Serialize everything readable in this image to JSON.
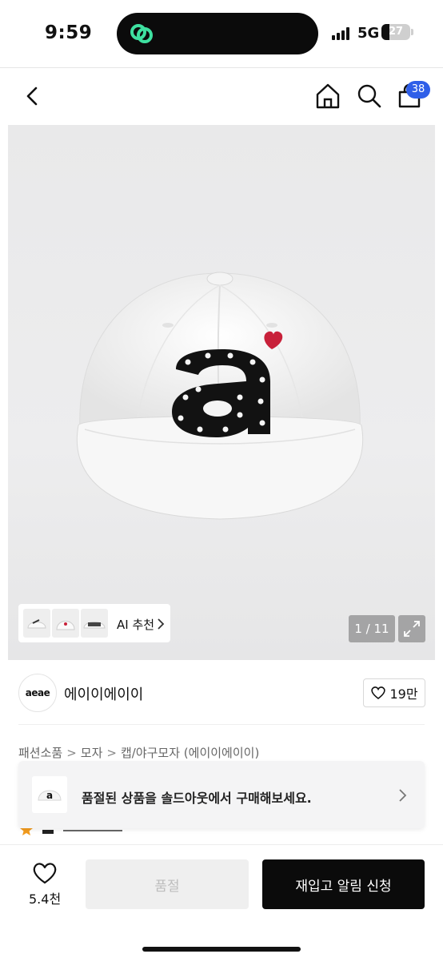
{
  "status_bar": {
    "time": "9:59",
    "network": "5G",
    "battery": "27"
  },
  "nav": {
    "cart_count": "38"
  },
  "gallery": {
    "ai_label": "AI 추천",
    "pager": "1 / 11"
  },
  "brand": {
    "logo_text": "aeae",
    "name": "에이이에이이",
    "likes": "19만"
  },
  "breadcrumb": [
    "패션소품",
    "모자",
    "캡/야구모자 (에이이에이이)"
  ],
  "toast": {
    "text": "품절된 상품을 솔드아웃에서 구매해보세요."
  },
  "bottom_bar": {
    "like_count": "5.4천",
    "soldout_label": "품절",
    "restock_label": "재입고 알림 신청"
  },
  "colors": {
    "accent": "#2f5fe8",
    "heart": "#c8213a",
    "black": "#0b0b0b"
  }
}
